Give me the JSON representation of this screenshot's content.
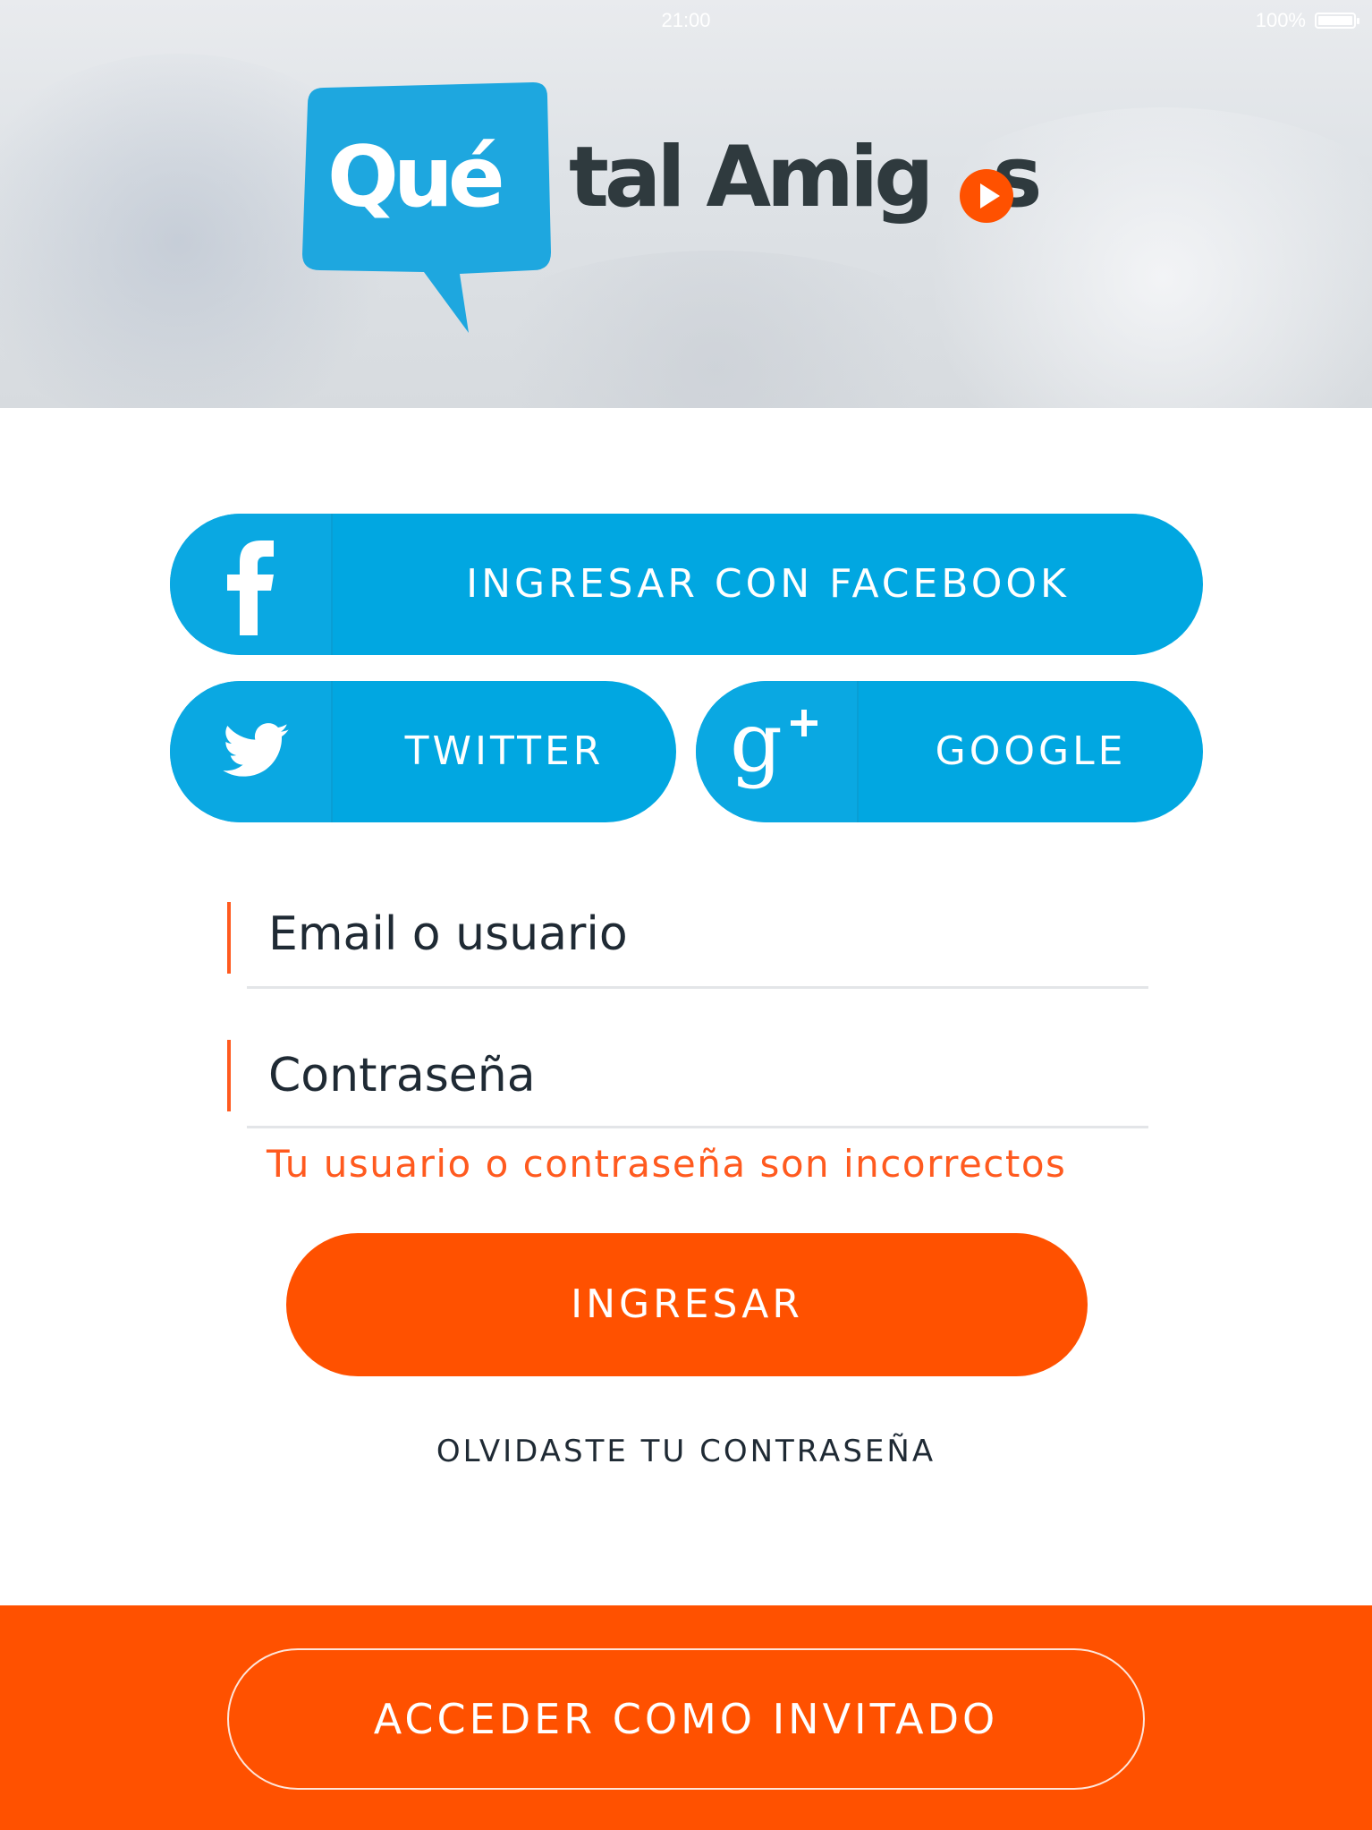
{
  "status_bar": {
    "time": "21:00",
    "battery": "100%"
  },
  "logo": {
    "word1": "Qué",
    "word2": "tal Amig",
    "word3": "s",
    "bubble_color": "#1ea7df",
    "text_color": "#2f3a3e",
    "play_color": "#ff5100"
  },
  "social": {
    "facebook_label": "INGRESAR CON FACEBOOK",
    "twitter_label": "TWITTER",
    "google_label": "GOOGLE",
    "facebook_icon": "facebook-icon",
    "twitter_icon": "twitter-icon",
    "google_icon": "google-plus-icon",
    "button_color": "#01a7e1"
  },
  "form": {
    "email_value": "Email o usuario",
    "password_value": "Contraseña",
    "error_message": "Tu usuario o contraseña son incorrectos",
    "login_label": "INGRESAR",
    "forgot_label": "OLVIDASTE TU CONTRASEÑA",
    "accent_color": "#ff5100"
  },
  "footer": {
    "guest_label": "ACCEDER COMO INVITADO"
  }
}
